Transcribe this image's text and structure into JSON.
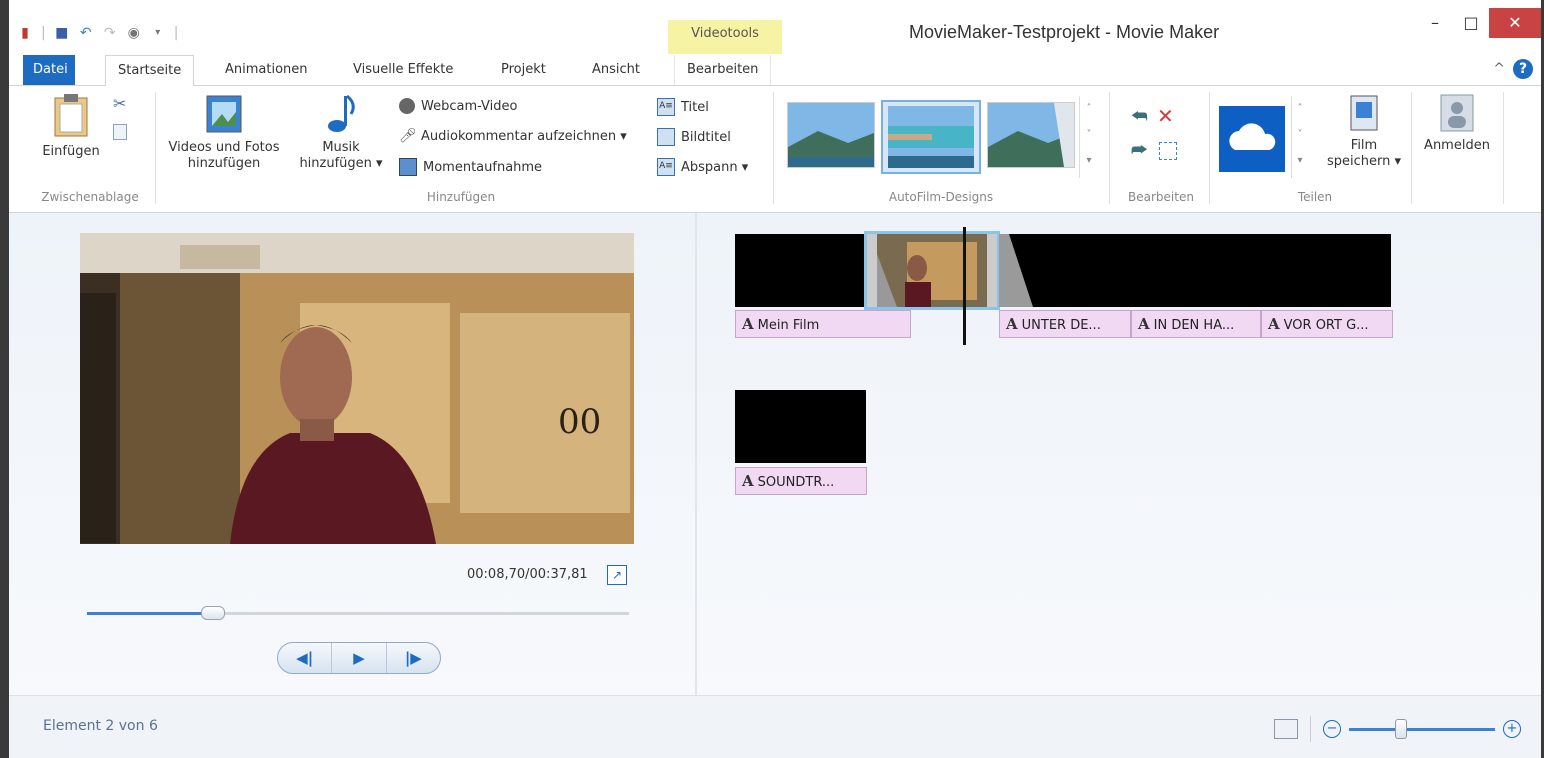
{
  "titlebar": {
    "app_title": "MovieMaker-Testprojekt - Movie Maker",
    "context_tab_group": "Videotools",
    "minimize": "–",
    "maximize": "□",
    "close": "✕"
  },
  "tabs": [
    {
      "label": "Datei"
    },
    {
      "label": "Startseite"
    },
    {
      "label": "Animationen"
    },
    {
      "label": "Visuelle Effekte"
    },
    {
      "label": "Projekt"
    },
    {
      "label": "Ansicht"
    },
    {
      "label": "Bearbeiten"
    }
  ],
  "ribbon": {
    "zwischenablage": {
      "label": "Zwischenablage",
      "einfuegen": "Einfügen"
    },
    "hinzufuegen": {
      "label": "Hinzufügen",
      "videos_line1": "Videos und Fotos",
      "videos_line2": "hinzufügen",
      "musik_line1": "Musik",
      "musik_line2": "hinzufügen ▾",
      "webcam": "Webcam-Video",
      "audiokommentar": "Audiokommentar aufzeichnen ▾",
      "momentaufnahme": "Momentaufnahme",
      "titel": "Titel",
      "bildtitel": "Bildtitel",
      "abspann": "Abspann ▾"
    },
    "autofilm": {
      "label": "AutoFilm-Designs"
    },
    "bearbeiten": {
      "label": "Bearbeiten"
    },
    "teilen": {
      "label": "Teilen",
      "film_line1": "Film",
      "film_line2": "speichern ▾"
    },
    "anmelden": "Anmelden"
  },
  "preview": {
    "timecode": "00:08,70/00:37,81",
    "seek_fraction": 0.23
  },
  "storyboard": {
    "captions_row1": [
      "Mein Film",
      "UNTER DE...",
      "IN DEN HA...",
      "VOR ORT G..."
    ],
    "captions_row2": [
      "SOUNDTR..."
    ]
  },
  "statusbar": {
    "status": "Element 2 von 6",
    "zoom_fraction": 0.35
  },
  "colors": {
    "accent": "#1e6bc2",
    "caption_bg": "#f1d9f3",
    "context_band": "#f7f3a4",
    "close_red": "#c94343"
  }
}
